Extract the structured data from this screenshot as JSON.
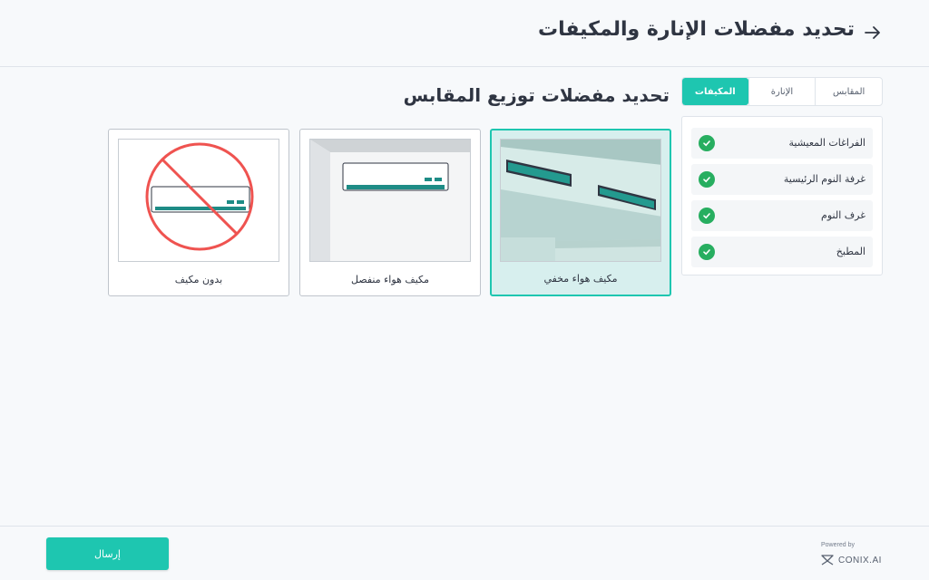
{
  "header": {
    "title": "تحديد مفضلات الإنارة والمكيفات",
    "back_icon": "arrow-right-icon"
  },
  "tabs": [
    {
      "label": "المقابس",
      "active": false
    },
    {
      "label": "الإنارة",
      "active": false
    },
    {
      "label": "المكيفات",
      "active": true
    }
  ],
  "section": {
    "title": "تحديد مفضلات توزيع المقابس"
  },
  "rooms": [
    {
      "label": "الفراغات المعيشية",
      "checked": true
    },
    {
      "label": "غرفة النوم الرئيسية",
      "checked": true
    },
    {
      "label": "غرف النوم",
      "checked": true
    },
    {
      "label": "المطبخ",
      "checked": true
    }
  ],
  "options": [
    {
      "label": "مكيف هواء مخفي",
      "selected": true
    },
    {
      "label": "مكيف هواء منفصل",
      "selected": false
    },
    {
      "label": "بدون مكيف",
      "selected": false
    }
  ],
  "footer": {
    "send_label": "إرسال",
    "powered_by": "Powered by",
    "brand": "CONIX.AI"
  },
  "colors": {
    "accent": "#1ec6b0",
    "check": "#27ae60",
    "selected_bg": "#d7efee",
    "no_ac_red": "#ef5350"
  }
}
